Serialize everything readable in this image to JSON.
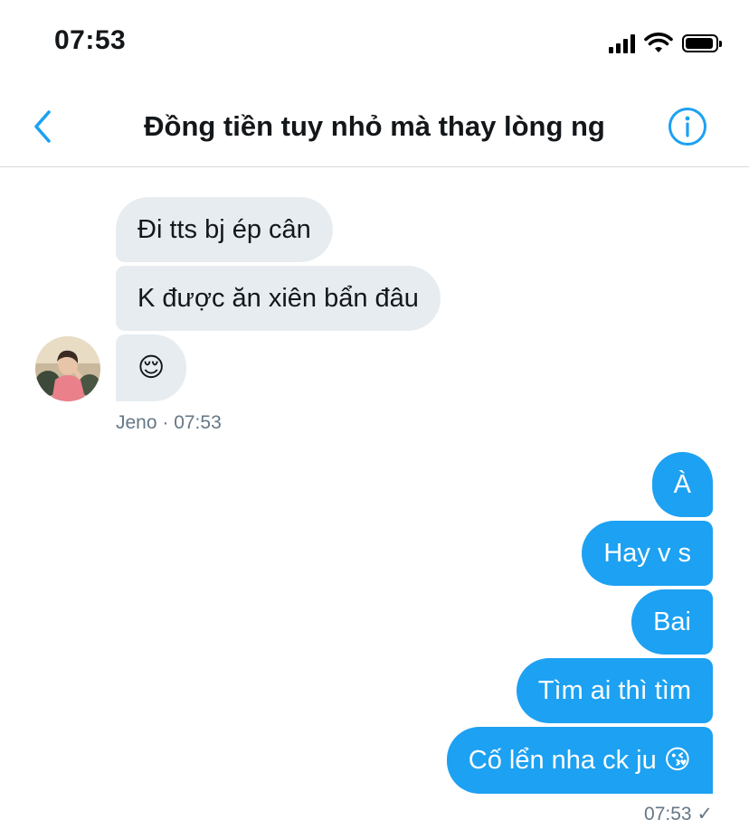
{
  "status_bar": {
    "time": "07:53"
  },
  "header": {
    "title": "Đồng tiền tuy nhỏ mà thay lòng ng"
  },
  "incoming": {
    "messages": [
      "Đi tts bj ép cân",
      "K được ăn xiên bẩn đâu",
      "😌"
    ],
    "meta": "Jeno · 07:53"
  },
  "outgoing": {
    "messages": [
      "À",
      "Hay v s",
      "Bai",
      "Tìm ai thì tìm",
      "Cố lển nha ck ju 😘"
    ],
    "meta": "07:53 ✓"
  },
  "colors": {
    "accent": "#1da1f2",
    "incoming_bubble": "#e6ecf0",
    "meta_text": "#657786"
  },
  "icons": [
    "back-chevron-icon",
    "info-icon",
    "signal-icon",
    "wifi-icon",
    "battery-icon"
  ]
}
